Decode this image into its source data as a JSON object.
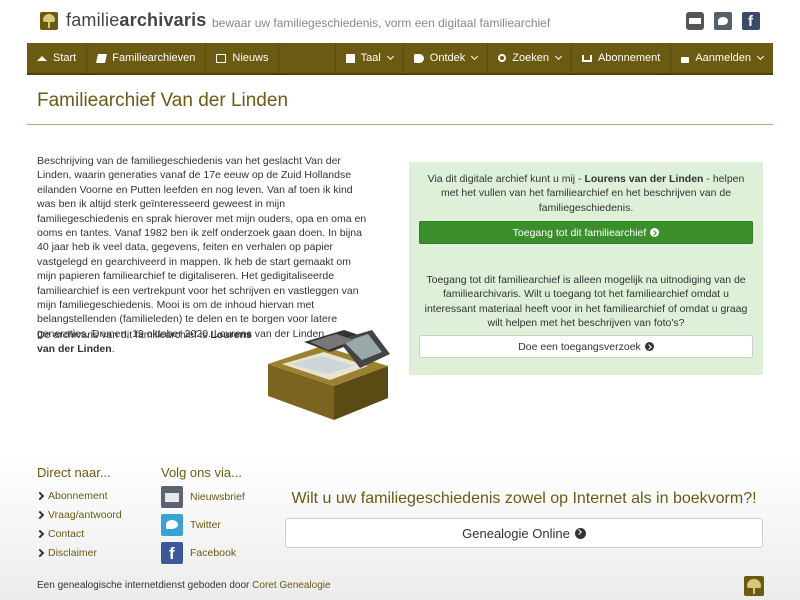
{
  "header": {
    "logo_prefix": "familie",
    "logo_bold": "archivaris",
    "tagline": "bewaar uw familiegeschiedenis, vorm een digitaal familiearchief",
    "icons": [
      "print-icon",
      "twitter-icon",
      "facebook-icon"
    ]
  },
  "nav": {
    "left": [
      {
        "label": "Start",
        "icon": "home-icon"
      },
      {
        "label": "Familiearchieven",
        "icon": "book-icon"
      },
      {
        "label": "Nieuws",
        "icon": "newspaper-icon"
      }
    ],
    "right": [
      {
        "label": "Taal",
        "icon": "language-icon",
        "dropdown": true
      },
      {
        "label": "Ontdek",
        "icon": "hand-pointer-icon",
        "dropdown": true
      },
      {
        "label": "Zoeken",
        "icon": "search-icon",
        "dropdown": true
      },
      {
        "label": "Abonnement",
        "icon": "cart-icon",
        "dropdown": false
      },
      {
        "label": "Aanmelden",
        "icon": "lock-icon",
        "dropdown": true
      }
    ]
  },
  "page": {
    "title": "Familiearchief Van der Linden",
    "description": "Beschrijving van de familiegeschiedenis van het geslacht Van der Linden, waarin generaties vanaf de 17e eeuw op de Zuid Hollandse eilanden Voorne en Putten leefden en nog leven. Van af toen ik kind was ben ik altijd sterk geïnteresseerd geweest in mijn familiegeschiedenis en sprak hierover met mijn ouders, opa en oma en ooms en tantes. Vanaf 1982 ben ik zelf onderzoek gaan doen. In bijna 40 jaar heb ik veel data, gegevens, feiten en verhalen op papier vastgelegd en gearchiveerd in mappen. Ik heb de start gemaakt om mijn papieren familiearchief te digitaliseren. Het gedigitaliseerde familiearchief is een vertrekpunt voor het schrijven en vastleggen van mijn familiegeschiedenis. Mooi is om de inhoud hiervan met belangstellenden (familieleden) te delen en te borgen voor latere generaties. Drunen, 19 oktober 2020. Lourens van der Linden.",
    "archivist_prefix": "De archivaris van dit familiearchief is ",
    "archivist_name": "Lourens van der Linden",
    "archivist_suffix": "."
  },
  "panel": {
    "text1_prefix": "Via dit digitale archief kunt u mij - ",
    "text1_name": "Lourens van der Linden",
    "text1_suffix": " - helpen met het vullen van het familiearchief en het beschrijven van de familiegeschiedenis.",
    "access_button": "Toegang tot dit familiearchief",
    "text2": "Toegang tot dit familiearchief is alleen mogelijk na uitnodiging van de familiearchivaris. Wilt u toegang tot het familiearchief omdat u interessant materiaal heeft voor in het familiearchief of omdat u graag wilt helpen met het beschrijven van foto's?",
    "request_button": "Doe een toegangsverzoek"
  },
  "footer": {
    "direct_heading": "Direct naar...",
    "direct_links": [
      "Abonnement",
      "Vraag/antwoord",
      "Contact",
      "Disclaimer"
    ],
    "follow_heading": "Volg ons via...",
    "follow_links": [
      "Nieuwsbrief",
      "Twitter",
      "Facebook"
    ],
    "promo": "Wilt u uw familiegeschiedenis zowel op Internet als in boekvorm?!",
    "promo_button": "Genealogie Online",
    "credit_prefix": "Een genealogische internetdienst geboden door ",
    "credit_link": "Coret Genealogie"
  },
  "colors": {
    "brand": "#6b5a12",
    "panel_bg": "#dff0d8",
    "access_button": "#3a8f2b"
  }
}
